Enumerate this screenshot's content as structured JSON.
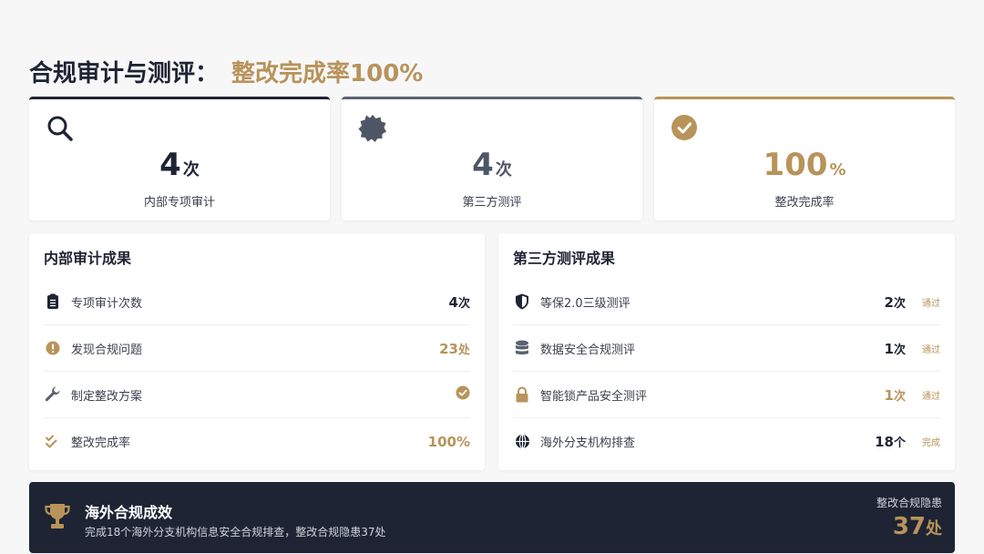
{
  "header": {
    "title": "合规审计与测评：",
    "highlight": "整改完成率100%"
  },
  "stats": [
    {
      "icon": "search-icon",
      "value": "4",
      "unit": "次",
      "label": "内部专项审计"
    },
    {
      "icon": "badge-icon",
      "value": "4",
      "unit": "次",
      "label": "第三方测评"
    },
    {
      "icon": "check-circle-icon",
      "value": "100",
      "unit": "%",
      "label": "整改完成率"
    }
  ],
  "internal": {
    "title": "内部审计成果",
    "rows": [
      {
        "icon": "clipboard-icon",
        "label": "专项审计次数",
        "value": "4",
        "unit": "次"
      },
      {
        "icon": "alert-circle-icon",
        "label": "发现合规问题",
        "value": "23",
        "unit": "处"
      },
      {
        "icon": "wrench-icon",
        "label": "制定整改方案",
        "value": ""
      },
      {
        "icon": "double-check-icon",
        "label": "整改完成率",
        "value": "100%",
        "unit": ""
      }
    ]
  },
  "third_party": {
    "title": "第三方测评成果",
    "rows": [
      {
        "icon": "shield-icon",
        "label": "等保2.0三级测评",
        "value": "2",
        "unit": "次",
        "status": "通过"
      },
      {
        "icon": "database-icon",
        "label": "数据安全合规测评",
        "value": "1",
        "unit": "次",
        "status": "通过"
      },
      {
        "icon": "lock-icon",
        "label": "智能锁产品安全测评",
        "value": "1",
        "unit": "次",
        "status": "通过"
      },
      {
        "icon": "globe-icon",
        "label": "海外分支机构排查",
        "value": "18",
        "unit": "个",
        "status": "完成"
      }
    ]
  },
  "banner": {
    "icon": "trophy-icon",
    "title": "海外合规成效",
    "desc": "完成18个海外分支机构信息安全合规排查，整改合规隐患37处",
    "right_label": "整改合规隐患",
    "right_value": "37",
    "right_unit": "处"
  },
  "colors": {
    "navy": "#1e2433",
    "gold": "#b8935a",
    "gray": "#5a6270"
  }
}
